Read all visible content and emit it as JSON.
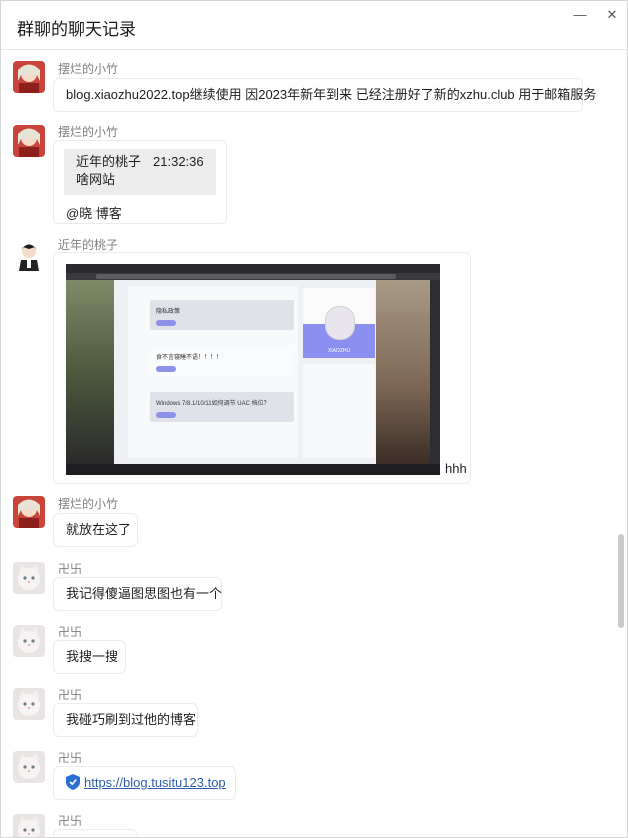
{
  "window": {
    "title": "群聊的聊天记录",
    "minimize_glyph": "—",
    "close_glyph": "✕"
  },
  "messages": [
    {
      "sender": "摆烂的小竹",
      "text": "blog.xiaozhu2022.top继续使用 因2023年新年到来 已经注册好了新的xzhu.club 用于邮箱服务"
    },
    {
      "sender": "摆烂的小竹",
      "quote_sender": "近年的桃子",
      "quote_time": "21:32:36",
      "quote_text": "啥网站",
      "text": "@晓 博客"
    },
    {
      "sender": "近年的桃子",
      "image_caption": "hhh",
      "screenshot": {
        "items": [
          "隐私政策",
          "食不言寝睡不语！！！！",
          "Windows 7/8.1/10/11如何调节 UAC 档位？"
        ],
        "profile_name": "XIAOZHU"
      }
    },
    {
      "sender": "摆烂的小竹",
      "text": "就放在这了"
    },
    {
      "sender": "卍卐",
      "text": "我记得傻逼图思图也有一个"
    },
    {
      "sender": "卍卐",
      "text": "我搜一搜"
    },
    {
      "sender": "卍卐",
      "text": "我碰巧刷到过他的博客"
    },
    {
      "sender": "卍卐",
      "link": "https://blog.tusitu123.top"
    },
    {
      "sender": "卍卐"
    }
  ],
  "icons": {
    "avatar_anime": "anime-girl-avatar",
    "avatar_boy": "boy-avatar",
    "avatar_cat": "white-cat-avatar",
    "shield": "shield-icon"
  }
}
